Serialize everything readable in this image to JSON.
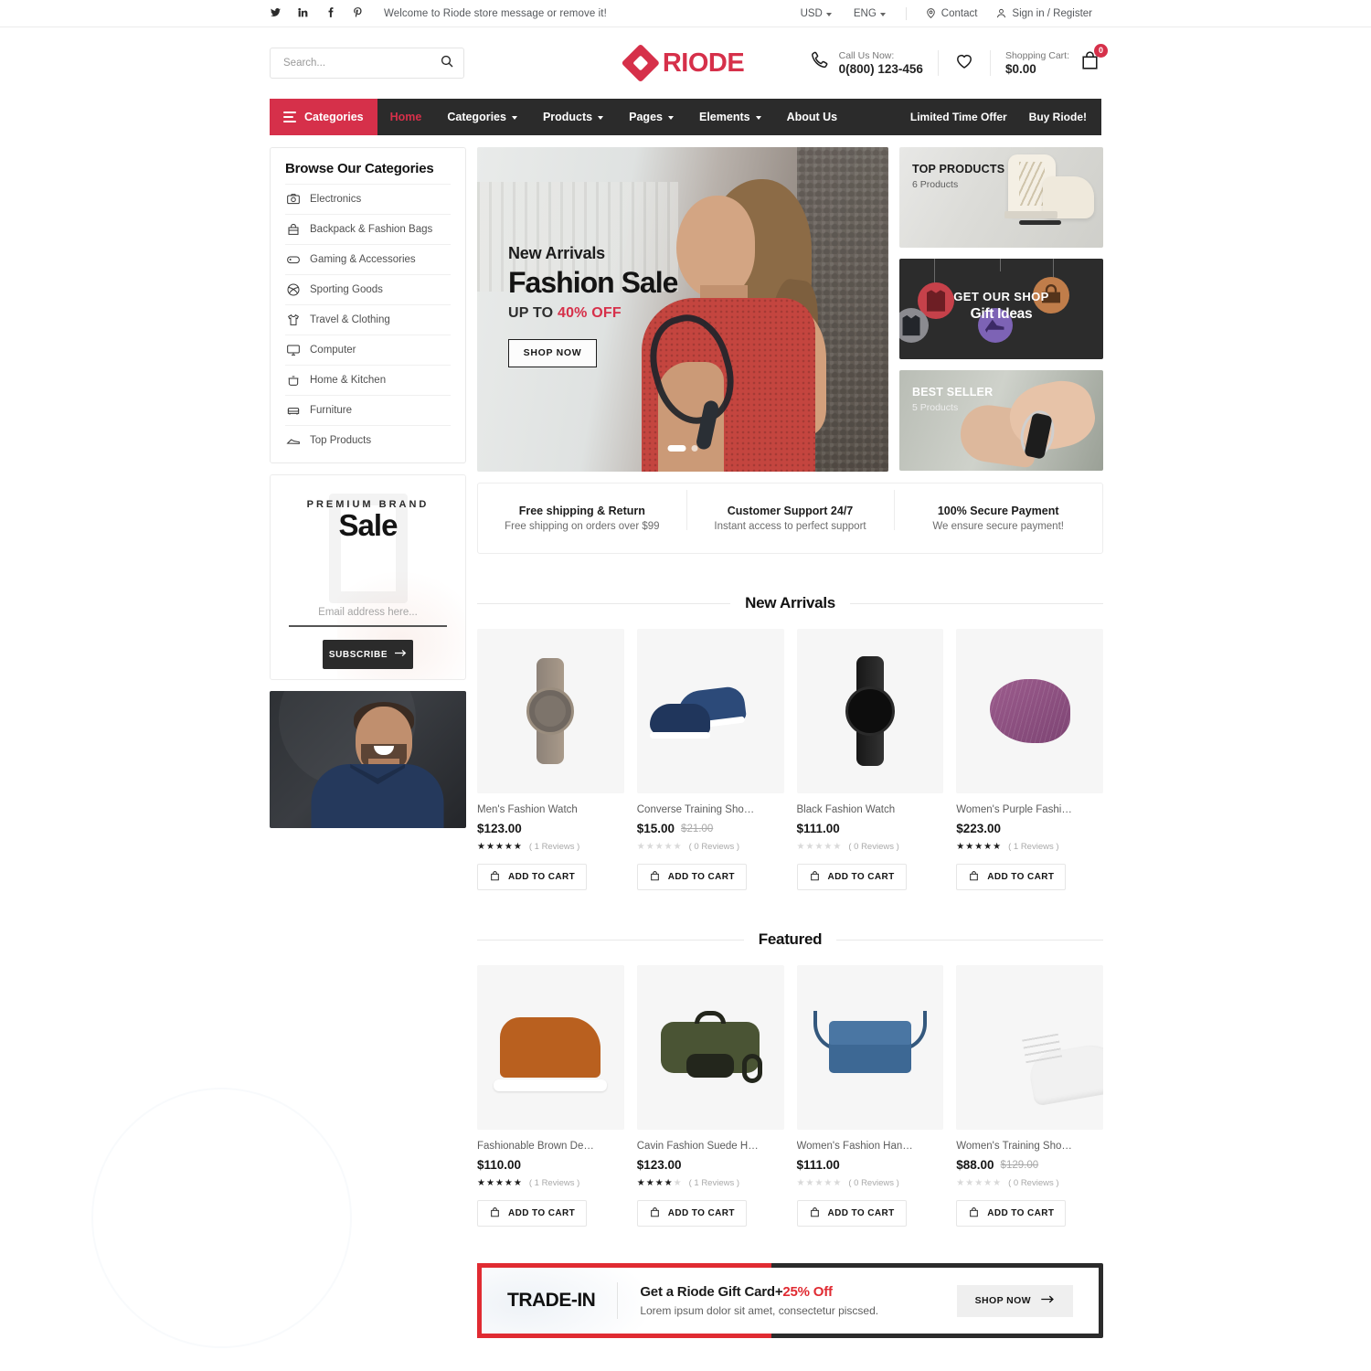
{
  "topbar": {
    "social": [
      {
        "name": "twitter-icon",
        "glyph": "ᴠ"
      },
      {
        "name": "linkedin-icon",
        "glyph": "in"
      },
      {
        "name": "facebook-icon",
        "glyph": "f"
      },
      {
        "name": "pinterest-icon",
        "glyph": "р"
      }
    ],
    "welcome": "Welcome to Riode store message or remove it!",
    "currency": "USD",
    "language": "ENG",
    "contact": "Contact",
    "account": "Sign in / Register"
  },
  "header": {
    "search_placeholder": "Search...",
    "search_value": "",
    "logo_text": "RIODE",
    "call_label": "Call Us Now:",
    "call_number": "0(800) 123-456",
    "cart_label": "Shopping Cart:",
    "cart_amount": "$0.00",
    "cart_count": "0"
  },
  "nav": {
    "categories_button": "Categories",
    "links": [
      {
        "label": "Home",
        "caret": false,
        "active": true
      },
      {
        "label": "Categories",
        "caret": true,
        "active": false
      },
      {
        "label": "Products",
        "caret": true,
        "active": false
      },
      {
        "label": "Pages",
        "caret": true,
        "active": false
      },
      {
        "label": "Elements",
        "caret": true,
        "active": false
      },
      {
        "label": "About Us",
        "caret": false,
        "active": false
      }
    ],
    "right_links": [
      {
        "label": "Limited Time Offer"
      },
      {
        "label": "Buy Riode!"
      }
    ]
  },
  "sidebar": {
    "title": "Browse Our Categories",
    "categories": [
      {
        "label": "Electronics",
        "icon": "camera-icon"
      },
      {
        "label": "Backpack & Fashion Bags",
        "icon": "bag-icon"
      },
      {
        "label": "Gaming & Accessories",
        "icon": "gamepad-icon"
      },
      {
        "label": "Sporting Goods",
        "icon": "ball-icon"
      },
      {
        "label": "Travel & Clothing",
        "icon": "shirt-icon"
      },
      {
        "label": "Computer",
        "icon": "monitor-icon"
      },
      {
        "label": "Home & Kitchen",
        "icon": "pot-icon"
      },
      {
        "label": "Furniture",
        "icon": "sofa-icon"
      },
      {
        "label": "Top Products",
        "icon": "shoe-icon"
      }
    ],
    "promo": {
      "brand": "PREMIUM BRAND",
      "sale": "Sale",
      "email_placeholder": "Email address here...",
      "email_value": "",
      "subscribe": "SUBSCRIBE"
    }
  },
  "hero": {
    "eyebrow": "New Arrivals",
    "title": "Fashion Sale",
    "subtitle_prefix": "UP TO ",
    "subtitle_accent": "40% OFF",
    "button": "SHOP NOW",
    "slides": 2,
    "active_slide": 1
  },
  "side_banners": [
    {
      "title": "TOP PRODUCTS",
      "subtitle": "6 Products",
      "name": "banner-top-products"
    },
    {
      "title": "GET OUR SHOP",
      "subtitle": "Gift Ideas",
      "name": "banner-gift-ideas"
    },
    {
      "title": "BEST SELLER",
      "subtitle": "5 Products",
      "name": "banner-best-seller"
    }
  ],
  "services": [
    {
      "title": "Free shipping & Return",
      "desc": "Free shipping on orders over $99"
    },
    {
      "title": "Customer Support 24/7",
      "desc": "Instant access to perfect support"
    },
    {
      "title": "100% Secure Payment",
      "desc": "We ensure secure payment!"
    }
  ],
  "sections": [
    {
      "title": "New Arrivals",
      "products": [
        {
          "name": "Men's Fashion Watch",
          "price": "$123.00",
          "old_price": "",
          "stars": 5,
          "reviews": "( 1 Reviews )",
          "add_to_cart": "ADD TO CART",
          "art": "watch-bronze"
        },
        {
          "name": "Converse Training Sho…",
          "price": "$15.00",
          "old_price": "$21.00",
          "stars": 0,
          "reviews": "( 0 Reviews )",
          "add_to_cart": "ADD TO CART",
          "art": "shoes-blue"
        },
        {
          "name": "Black Fashion Watch",
          "price": "$111.00",
          "old_price": "",
          "stars": 0,
          "reviews": "( 0 Reviews )",
          "add_to_cart": "ADD TO CART",
          "art": "watch-black"
        },
        {
          "name": "Women's Purple Fashi…",
          "price": "$223.00",
          "old_price": "",
          "stars": 5,
          "reviews": "( 1 Reviews )",
          "add_to_cart": "ADD TO CART",
          "art": "beanie-purple"
        }
      ]
    },
    {
      "title": "Featured",
      "products": [
        {
          "name": "Fashionable Brown De…",
          "price": "$110.00",
          "old_price": "",
          "stars": 5,
          "reviews": "( 1 Reviews )",
          "add_to_cart": "ADD TO CART",
          "art": "shoe-brown"
        },
        {
          "name": "Cavin Fashion Suede H…",
          "price": "$123.00",
          "old_price": "",
          "stars": 4,
          "reviews": "( 1 Reviews )",
          "add_to_cart": "ADD TO CART",
          "art": "duffel-green"
        },
        {
          "name": "Women's Fashion Han…",
          "price": "$111.00",
          "old_price": "",
          "stars": 0,
          "reviews": "( 0 Reviews )",
          "add_to_cart": "ADD TO CART",
          "art": "handbag-blue"
        },
        {
          "name": "Women's Training Sho…",
          "price": "$88.00",
          "old_price": "$129.00",
          "stars": 0,
          "reviews": "( 0 Reviews )",
          "add_to_cart": "ADD TO CART",
          "art": "sneaker-white"
        }
      ]
    }
  ],
  "trade_banner": {
    "label": "TRADE-IN",
    "headline_prefix": "Get a Riode Gift Card+",
    "headline_accent": "25% Off",
    "text": "Lorem ipsum dolor sit amet, consectetur piscsed.",
    "button": "SHOP NOW"
  },
  "colors": {
    "brand_red": "#d6304a",
    "banner_red": "#e02b32",
    "nav_dark": "#2b2b2b",
    "text_dark": "#161616"
  }
}
